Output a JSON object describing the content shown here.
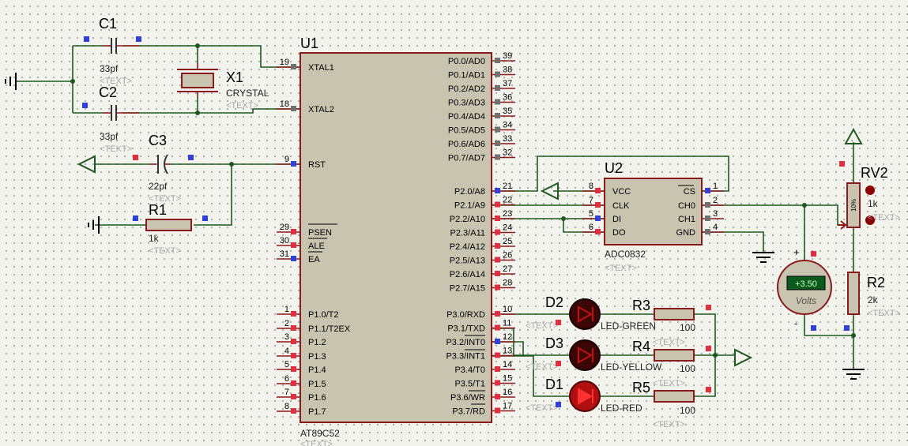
{
  "title": "Proteus schematic",
  "components": {
    "c1": {
      "ref": "C1",
      "value": "33pf",
      "text": "<TEXT>"
    },
    "c2": {
      "ref": "C2",
      "value": "33pf",
      "text": "<TEXT>"
    },
    "c3": {
      "ref": "C3",
      "value": "22pf",
      "text": "<TEXT>"
    },
    "x1": {
      "ref": "X1",
      "value": "CRYSTAL",
      "text": "<TEXT>"
    },
    "r1": {
      "ref": "R1",
      "value": "1k",
      "text": "<TEXT>"
    },
    "u1": {
      "ref": "U1",
      "part": "AT89C52",
      "text": "<TEXT>"
    },
    "u2": {
      "ref": "U2",
      "part": "ADC0832",
      "text": "<TEXT>"
    },
    "rv2": {
      "ref": "RV2",
      "value": "1k",
      "text": "<TEXT>",
      "wiper": "10%"
    },
    "r2": {
      "ref": "R2",
      "value": "2k",
      "text": "<TEXT>"
    },
    "d1": {
      "ref": "D1",
      "value": "LED-RED",
      "text": "<TEXT>"
    },
    "d2": {
      "ref": "D2",
      "value": "LED-GREEN",
      "text": "<TEXT>"
    },
    "d3": {
      "ref": "D3",
      "value": "LED-YELLOW",
      "text": "<TEXT>"
    },
    "r3": {
      "ref": "R3",
      "value": "100",
      "text": "<TEXT>"
    },
    "r4": {
      "ref": "R4",
      "value": "100",
      "text": "<TEXT>"
    },
    "r5": {
      "ref": "R5",
      "value": "100",
      "text": "<TEXT>"
    },
    "voltmeter": {
      "reading": "+3.50",
      "unit": "Volts",
      "plus": "+",
      "minus": "-"
    }
  },
  "u1_left_pins": [
    {
      "num": "19",
      "name": "XTAL1"
    },
    {
      "num": "18",
      "name": "XTAL2"
    },
    {
      "num": "9",
      "name": "RST"
    },
    {
      "num": "29",
      "name": "PSEN"
    },
    {
      "num": "30",
      "name": "ALE"
    },
    {
      "num": "31",
      "name": "EA"
    },
    {
      "num": "1",
      "name": "P1.0/T2"
    },
    {
      "num": "2",
      "name": "P1.1/T2EX"
    },
    {
      "num": "3",
      "name": "P1.2"
    },
    {
      "num": "4",
      "name": "P1.3"
    },
    {
      "num": "5",
      "name": "P1.4"
    },
    {
      "num": "6",
      "name": "P1.5"
    },
    {
      "num": "7",
      "name": "P1.6"
    },
    {
      "num": "8",
      "name": "P1.7"
    }
  ],
  "u1_right_pins": [
    {
      "num": "39",
      "name": "P0.0/AD0"
    },
    {
      "num": "38",
      "name": "P0.1/AD1"
    },
    {
      "num": "37",
      "name": "P0.2/AD2"
    },
    {
      "num": "36",
      "name": "P0.3/AD3"
    },
    {
      "num": "35",
      "name": "P0.4/AD4"
    },
    {
      "num": "34",
      "name": "P0.5/AD5"
    },
    {
      "num": "33",
      "name": "P0.6/AD6"
    },
    {
      "num": "32",
      "name": "P0.7/AD7"
    },
    {
      "num": "21",
      "name": "P2.0/A8"
    },
    {
      "num": "22",
      "name": "P2.1/A9"
    },
    {
      "num": "23",
      "name": "P2.2/A10"
    },
    {
      "num": "24",
      "name": "P2.3/A11"
    },
    {
      "num": "25",
      "name": "P2.4/A12"
    },
    {
      "num": "26",
      "name": "P2.5/A13"
    },
    {
      "num": "27",
      "name": "P2.6/A14"
    },
    {
      "num": "28",
      "name": "P2.7/A15"
    },
    {
      "num": "10",
      "name": "P3.0/RXD"
    },
    {
      "num": "11",
      "name": "P3.1/TXD"
    },
    {
      "num": "12",
      "name": "P3.2/INT0"
    },
    {
      "num": "13",
      "name": "P3.3/INT1"
    },
    {
      "num": "14",
      "name": "P3.4/T0"
    },
    {
      "num": "15",
      "name": "P3.5/T1"
    },
    {
      "num": "16",
      "name": "P3.6/WR"
    },
    {
      "num": "17",
      "name": "P3.7/RD"
    }
  ],
  "u2_left_pins": [
    {
      "num": "8",
      "name": "VCC"
    },
    {
      "num": "7",
      "name": "CLK"
    },
    {
      "num": "5",
      "name": "DI"
    },
    {
      "num": "6",
      "name": "DO"
    }
  ],
  "u2_right_pins": [
    {
      "num": "1",
      "name": "CS"
    },
    {
      "num": "2",
      "name": "CH0"
    },
    {
      "num": "3",
      "name": "CH1"
    },
    {
      "num": "4",
      "name": "GND"
    }
  ]
}
